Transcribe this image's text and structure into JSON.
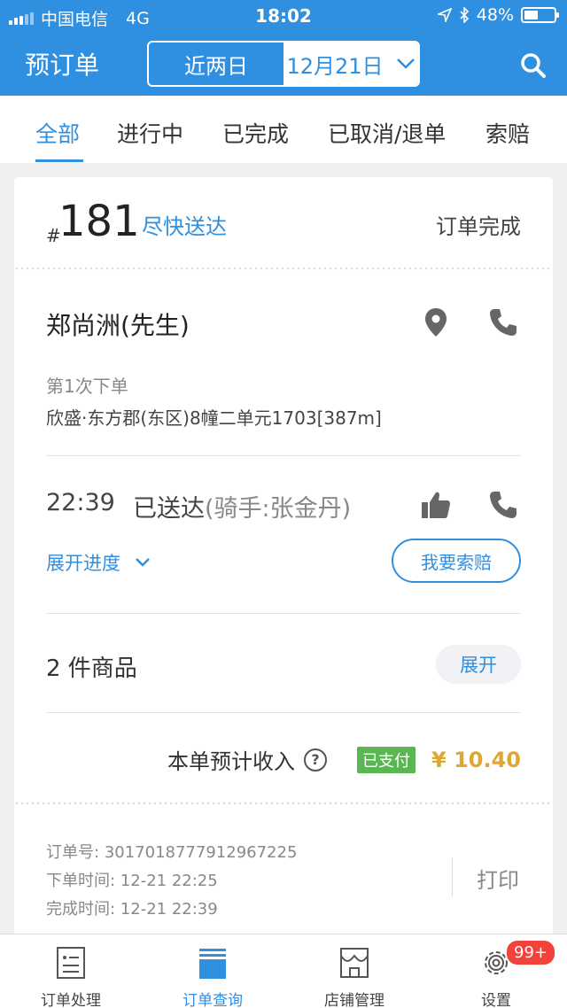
{
  "status_bar": {
    "carrier": "中国电信",
    "network": "4G",
    "time": "18:02",
    "battery": "48%",
    "battery_level": 0.48,
    "icons": [
      "location-arrow-icon",
      "bluetooth-icon",
      "battery-icon"
    ]
  },
  "header": {
    "title": "预订单",
    "date_range": "近两日",
    "date_select": "12月21日",
    "search_icon": "search-icon",
    "bg_color": "#2f8fe0"
  },
  "tabs": [
    {
      "label": "全部",
      "active": true
    },
    {
      "label": "进行中",
      "active": false
    },
    {
      "label": "已完成",
      "active": false
    },
    {
      "label": "已取消/退单",
      "active": false
    },
    {
      "label": "索赔",
      "active": false
    }
  ],
  "order": {
    "hash": "#",
    "number": "181",
    "tag": "尽快送达",
    "status": "订单完成",
    "customer_name": "郑尚洲(先生)",
    "order_count": "第1次下单",
    "address": "欣盛·东方郡(东区)8幢二单元1703[387m]",
    "delivery_time": "22:39",
    "delivery_status": "已送达",
    "rider": "(骑手:张金丹)",
    "expand_progress": "展开进度",
    "claim_button": "我要索赔",
    "goods_count": "2 件商品",
    "expand_button": "展开",
    "income_label": "本单预计收入",
    "paid_badge": "已支付",
    "amount": "¥ 10.40",
    "order_id_label": "订单号:",
    "order_id": "3017018777912967225",
    "order_time_label": "下单时间:",
    "order_time": "12-21 22:25",
    "complete_time_label": "完成时间:",
    "complete_time": "12-21 22:39",
    "print_button": "打印",
    "accent_color": "#2f8fe0",
    "amount_color": "#e0a632",
    "paid_color": "#5ab552"
  },
  "bottom_nav": {
    "items": [
      {
        "label": "订单处理",
        "icon": "document-icon",
        "active": false
      },
      {
        "label": "订单查询",
        "icon": "stack-icon",
        "active": true
      },
      {
        "label": "店铺管理",
        "icon": "store-icon",
        "active": false
      },
      {
        "label": "设置",
        "icon": "gear-icon",
        "active": false
      }
    ],
    "badge": "99+"
  }
}
